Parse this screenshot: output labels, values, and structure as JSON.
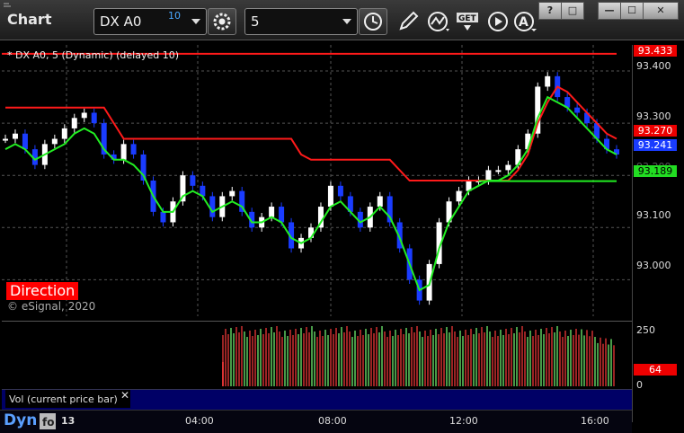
{
  "window": {
    "title": "Chart",
    "controls": [
      "?",
      "□",
      "—",
      "☐",
      "✕"
    ]
  },
  "toolbar": {
    "symbol": "DX A0",
    "symbol_count": "10",
    "interval": "5"
  },
  "chart": {
    "legend": "* DX A0, 5 (Dynamic) (delayed 10)",
    "study_label": "Direction",
    "copyright": "© eSignal, 2020",
    "price_axis": [
      "93.400",
      "93.300",
      "93.200",
      "93.100",
      "93.000"
    ],
    "price_tags": {
      "top_line": "93.433",
      "red_ma": "93.270",
      "last": "93.241",
      "green_ma": "93.189"
    },
    "volume_axis": [
      "250",
      "0"
    ],
    "volume_tag": "64",
    "volume_label": "Vol (current price bar)",
    "time_labels": [
      "13",
      "04:00",
      "08:00",
      "12:00",
      "16:00"
    ],
    "footer": "Dyn",
    "colors": {
      "up": "#ffffff",
      "down": "#1a3cff",
      "red_ma": "#ff1a1a",
      "green_ma": "#22ee22",
      "grid": "#555555"
    }
  },
  "chart_data": {
    "type": "line",
    "x_range_hours": [
      "00:00",
      "17:00"
    ],
    "ylim": [
      92.93,
      93.45
    ],
    "series": [
      {
        "close": [
          93.27,
          93.28,
          93.25,
          93.22,
          93.26,
          93.27,
          93.29,
          93.31,
          93.32,
          93.3,
          93.24,
          93.23,
          93.26,
          93.24,
          93.19,
          93.13,
          93.11,
          93.15,
          93.2,
          93.18,
          93.16,
          93.12,
          93.16,
          93.17,
          93.13,
          93.1,
          93.12,
          93.14,
          93.11,
          93.06,
          93.08,
          93.1,
          93.14,
          93.18,
          93.16,
          93.13,
          93.1,
          93.14,
          93.16,
          93.11,
          93.06,
          93.0,
          92.96,
          93.03,
          93.11,
          93.15,
          93.17,
          93.19,
          93.19,
          93.21,
          93.21,
          93.22,
          93.25,
          93.28,
          93.37,
          93.39,
          93.35,
          93.33,
          93.32,
          93.3,
          93.27,
          93.25,
          93.24
        ],
        "red": [
          93.33,
          93.33,
          93.33,
          93.33,
          93.33,
          93.33,
          93.33,
          93.33,
          93.33,
          93.33,
          93.33,
          93.3,
          93.27,
          93.27,
          93.27,
          93.27,
          93.27,
          93.27,
          93.27,
          93.27,
          93.27,
          93.27,
          93.27,
          93.27,
          93.27,
          93.27,
          93.27,
          93.27,
          93.27,
          93.27,
          93.24,
          93.23,
          93.23,
          93.23,
          93.23,
          93.23,
          93.23,
          93.23,
          93.23,
          93.23,
          93.21,
          93.19,
          93.19,
          93.19,
          93.19,
          93.19,
          93.19,
          93.19,
          93.19,
          93.19,
          93.19,
          93.19,
          93.21,
          93.24,
          93.3,
          93.34,
          93.37,
          93.36,
          93.34,
          93.32,
          93.3,
          93.28,
          93.27
        ],
        "green": [
          93.25,
          93.26,
          93.25,
          93.23,
          93.24,
          93.25,
          93.26,
          93.28,
          93.29,
          93.28,
          93.25,
          93.23,
          93.23,
          93.22,
          93.2,
          93.16,
          93.13,
          93.13,
          93.16,
          93.17,
          93.16,
          93.13,
          93.14,
          93.15,
          93.14,
          93.11,
          93.11,
          93.12,
          93.11,
          93.08,
          93.07,
          93.08,
          93.11,
          93.14,
          93.15,
          93.13,
          93.11,
          93.12,
          93.14,
          93.12,
          93.08,
          93.03,
          92.98,
          92.99,
          93.06,
          93.11,
          93.14,
          93.17,
          93.18,
          93.19,
          93.19,
          93.2,
          93.22,
          93.25,
          93.31,
          93.35,
          93.34,
          93.33,
          93.31,
          93.29,
          93.27,
          93.25,
          93.24
        ]
      }
    ]
  }
}
